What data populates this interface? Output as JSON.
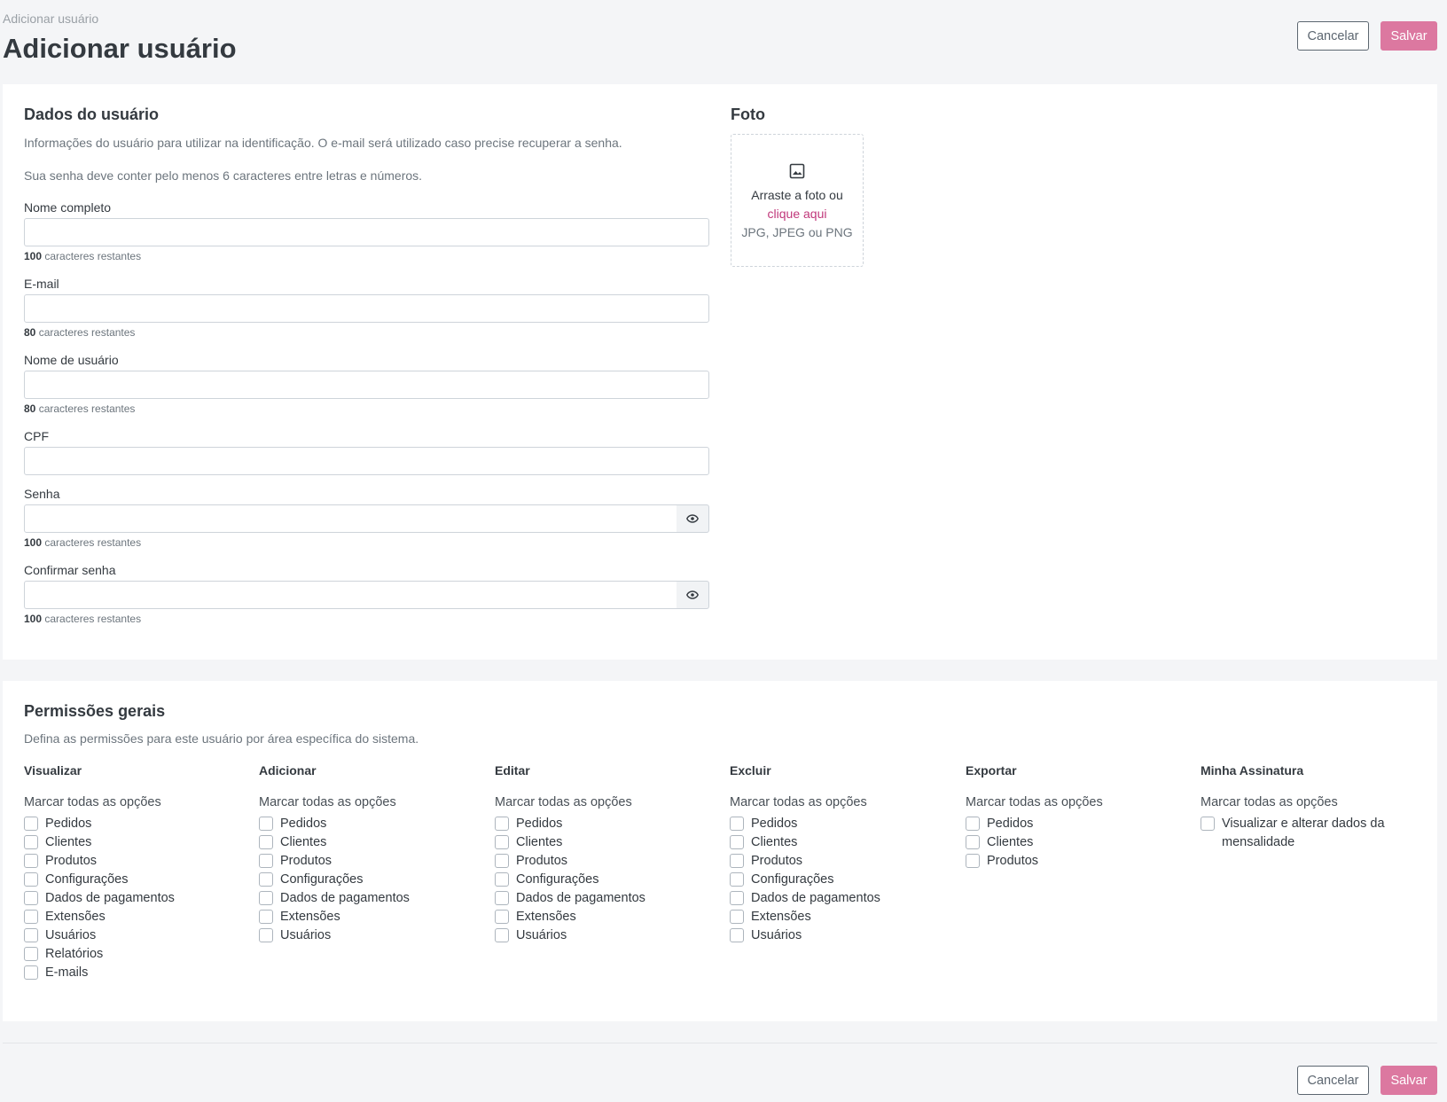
{
  "header": {
    "breadcrumb": "Adicionar usuário",
    "title": "Adicionar usuário",
    "cancel_label": "Cancelar",
    "save_label": "Salvar"
  },
  "user_data": {
    "title": "Dados do usuário",
    "description1": "Informações do usuário para utilizar na identificação. O e-mail será utilizado caso precise recuperar a senha.",
    "description2": "Sua senha deve conter pelo menos 6 caracteres entre letras e números.",
    "remaining_suffix": "caracteres restantes",
    "fields": {
      "full_name": {
        "label": "Nome completo",
        "value": "",
        "remaining": "100"
      },
      "email": {
        "label": "E-mail",
        "value": "",
        "remaining": "80"
      },
      "username": {
        "label": "Nome de usuário",
        "value": "",
        "remaining": "80"
      },
      "cpf": {
        "label": "CPF",
        "value": ""
      },
      "password": {
        "label": "Senha",
        "value": "",
        "remaining": "100"
      },
      "confirm_password": {
        "label": "Confirmar senha",
        "value": "",
        "remaining": "100"
      }
    }
  },
  "photo": {
    "title": "Foto",
    "drag_text": "Arraste a foto ou",
    "click_text": "clique aqui",
    "types": "JPG, JPEG ou PNG"
  },
  "permissions": {
    "title": "Permissões gerais",
    "description": "Defina as permissões para este usuário por área específica do sistema.",
    "select_all": "Marcar todas as opções",
    "columns": [
      {
        "title": "Visualizar",
        "items": [
          "Pedidos",
          "Clientes",
          "Produtos",
          "Configurações",
          "Dados de pagamentos",
          "Extensões",
          "Usuários",
          "Relatórios",
          "E-mails"
        ]
      },
      {
        "title": "Adicionar",
        "items": [
          "Pedidos",
          "Clientes",
          "Produtos",
          "Configurações",
          "Dados de pagamentos",
          "Extensões",
          "Usuários"
        ]
      },
      {
        "title": "Editar",
        "items": [
          "Pedidos",
          "Clientes",
          "Produtos",
          "Configurações",
          "Dados de pagamentos",
          "Extensões",
          "Usuários"
        ]
      },
      {
        "title": "Excluir",
        "items": [
          "Pedidos",
          "Clientes",
          "Produtos",
          "Configurações",
          "Dados de pagamentos",
          "Extensões",
          "Usuários"
        ]
      },
      {
        "title": "Exportar",
        "items": [
          "Pedidos",
          "Clientes",
          "Produtos"
        ]
      },
      {
        "title": "Minha Assinatura",
        "items": [
          "Visualizar e alterar dados da mensalidade"
        ]
      }
    ]
  },
  "colors": {
    "accent": "#dc78a0",
    "link": "#c0377a",
    "background": "#f4f5f7"
  }
}
